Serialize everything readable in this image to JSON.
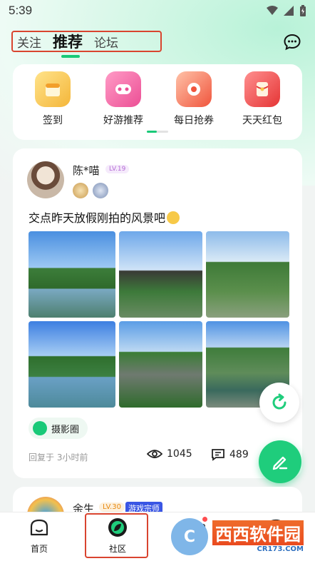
{
  "status_bar": {
    "time": "5:39"
  },
  "top_tabs": [
    {
      "label": "关注"
    },
    {
      "label": "推荐"
    },
    {
      "label": "论坛"
    }
  ],
  "quick_entries": [
    {
      "label": "签到",
      "icon": "sign-in-icon",
      "color": "#f7c44a"
    },
    {
      "label": "好游推荐",
      "icon": "game-recommend-icon",
      "color": "#f26aa6"
    },
    {
      "label": "每日抢券",
      "icon": "coupon-icon",
      "color": "#f0634a"
    },
    {
      "label": "天天红包",
      "icon": "red-packet-icon",
      "color": "#ef4d4d"
    }
  ],
  "post": {
    "username": "陈*喵",
    "level": "LV.19",
    "caption": "交点昨天放假刚拍的风景吧",
    "tag": "摄影圈",
    "time": "回复于 3小时前",
    "views": "1045",
    "comments": "489"
  },
  "post2": {
    "username": "余生",
    "level": "LV.30",
    "title": "游戏宗师"
  },
  "nav": [
    {
      "label": "首页",
      "icon": "home-icon"
    },
    {
      "label": "社区",
      "icon": "community-icon"
    },
    {
      "label": "",
      "icon": "gift-icon"
    },
    {
      "label": "",
      "icon": "profile-icon"
    }
  ],
  "watermark": {
    "text": "西西软件园",
    "sub": "CR173.COM"
  },
  "colors": {
    "accent": "#19c978",
    "highlight_box": "#d9442f"
  }
}
